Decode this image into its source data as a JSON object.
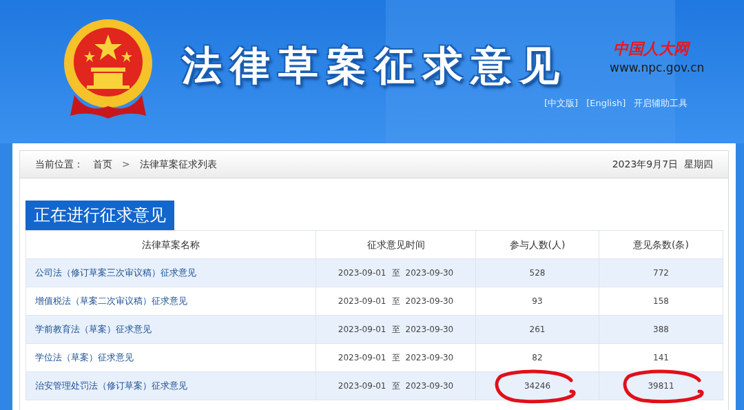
{
  "header": {
    "title": "法律草案征求意见",
    "site_logo": {
      "name": "中国人大网",
      "url": "www.npc.gov.cn"
    },
    "links": [
      "[中文版]",
      "[English]",
      "开启辅助工具"
    ]
  },
  "breadcrumb": {
    "label": "当前位置：",
    "items": [
      "首页",
      "法律草案征求列表"
    ],
    "separator": ">",
    "date": "2023年9月7日  星期四"
  },
  "section_title": "正在进行征求意见",
  "table": {
    "columns": [
      "法律草案名称",
      "征求意见时间",
      "参与人数(人)",
      "意见条数(条)"
    ],
    "rows": [
      {
        "name": "公司法（修订草案三次审议稿）征求意见",
        "start": "2023-09-01",
        "to": "至",
        "end": "2023-09-30",
        "participants": "528",
        "comments": "772",
        "circled": false
      },
      {
        "name": "增值税法（草案二次审议稿）征求意见",
        "start": "2023-09-01",
        "to": "至",
        "end": "2023-09-30",
        "participants": "93",
        "comments": "158",
        "circled": false
      },
      {
        "name": "学前教育法（草案）征求意见",
        "start": "2023-09-01",
        "to": "至",
        "end": "2023-09-30",
        "participants": "261",
        "comments": "388",
        "circled": false
      },
      {
        "name": "学位法（草案）征求意见",
        "start": "2023-09-01",
        "to": "至",
        "end": "2023-09-30",
        "participants": "82",
        "comments": "141",
        "circled": false
      },
      {
        "name": "治安管理处罚法（修订草案）征求意见",
        "start": "2023-09-01",
        "to": "至",
        "end": "2023-09-30",
        "participants": "34246",
        "comments": "39811",
        "circled": true
      }
    ]
  }
}
